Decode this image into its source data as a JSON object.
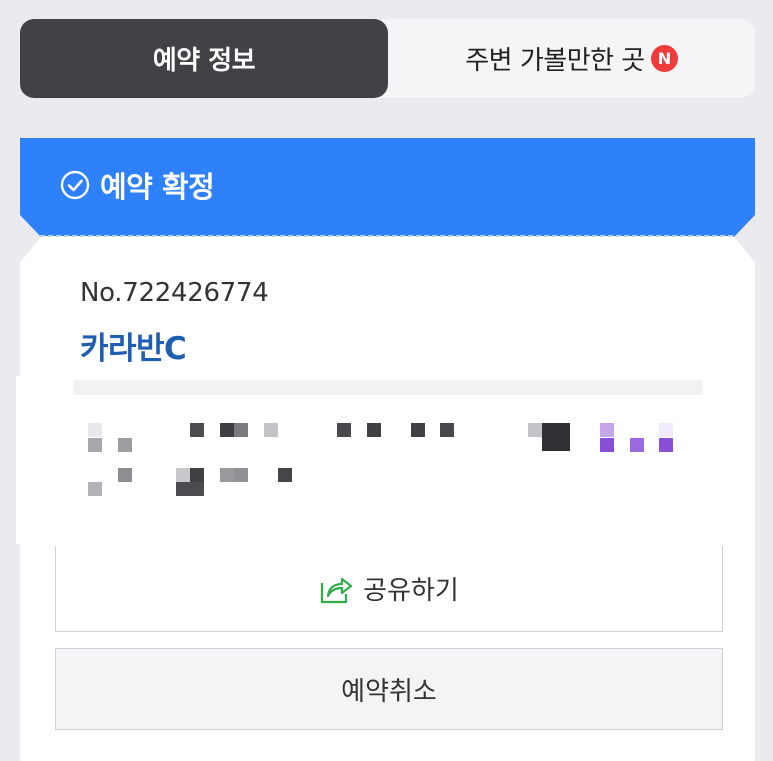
{
  "tabs": {
    "active_label": "예약 정보",
    "inactive_label": "주변 가볼만한 곳",
    "new_badge": "N"
  },
  "banner": {
    "status_label": "예약 확정",
    "color": "#2f80fb"
  },
  "reservation": {
    "number": "No.722426774",
    "place_name": "카라반C"
  },
  "actions": {
    "share_label": "공유하기",
    "cancel_label": "예약취소"
  },
  "icons": {
    "status": "check-circle-icon",
    "share": "share-icon"
  },
  "colors": {
    "accent": "#2f80fb",
    "place_name": "#1f5fb3",
    "badge": "#ee3b3b",
    "share_icon": "#2fae4a"
  }
}
